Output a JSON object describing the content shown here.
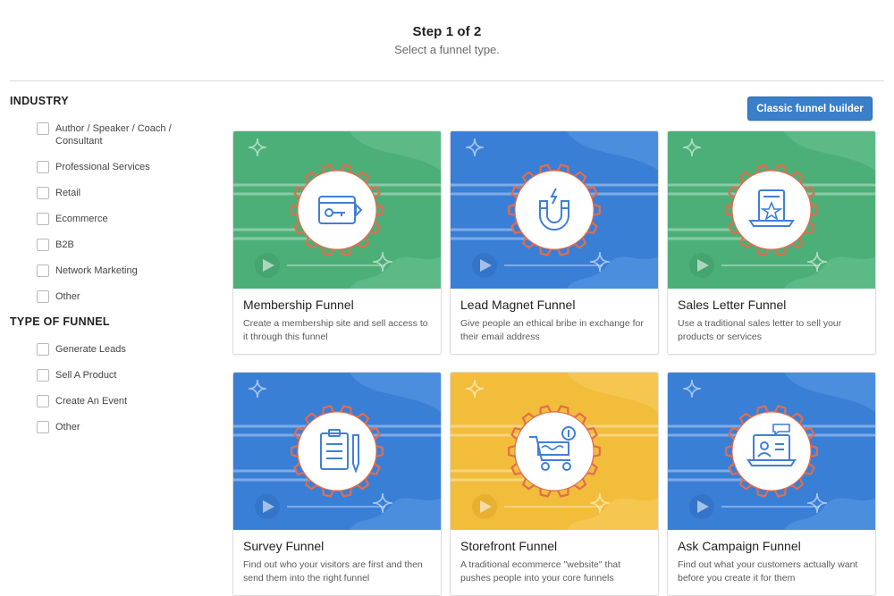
{
  "header": {
    "step": "Step 1 of 2",
    "subtitle": "Select a funnel type."
  },
  "filters": {
    "industry_title": "INDUSTRY",
    "industry": [
      {
        "label": "Author / Speaker / Coach / Consultant",
        "checked": false
      },
      {
        "label": "Professional Services",
        "checked": false
      },
      {
        "label": "Retail",
        "checked": false
      },
      {
        "label": "Ecommerce",
        "checked": false
      },
      {
        "label": "B2B",
        "checked": false
      },
      {
        "label": "Network Marketing",
        "checked": false
      },
      {
        "label": "Other",
        "checked": false
      }
    ],
    "type_title": "TYPE OF FUNNEL",
    "type": [
      {
        "label": "Generate Leads",
        "checked": false
      },
      {
        "label": "Sell A Product",
        "checked": false
      },
      {
        "label": "Create An Event",
        "checked": false
      },
      {
        "label": "Other",
        "checked": false
      }
    ]
  },
  "actions": {
    "classic_builder": "Classic funnel builder"
  },
  "colors": {
    "green": "#4caf78",
    "blue": "#3a7fd6",
    "yellow": "#f2bd3b",
    "accent_button": "#3a7fc9",
    "badge_orange": "#e0704f",
    "icon_blue": "#3f7fd6"
  },
  "cards": [
    {
      "title": "Membership Funnel",
      "desc": "Create a membership site and sell access to it through this funnel",
      "theme": "green",
      "icon": "membership-card-icon"
    },
    {
      "title": "Lead Magnet Funnel",
      "desc": "Give people an ethical bribe in exchange for their email address",
      "theme": "blue",
      "icon": "magnet-icon"
    },
    {
      "title": "Sales Letter Funnel",
      "desc": "Use a traditional sales letter to sell your products or services",
      "theme": "green",
      "icon": "sales-letter-icon"
    },
    {
      "title": "Survey Funnel",
      "desc": "Find out who your visitors are first and then send them into the right funnel",
      "theme": "blue",
      "icon": "clipboard-icon"
    },
    {
      "title": "Storefront Funnel",
      "desc": "A traditional ecommerce \"website\" that pushes people into your core funnels",
      "theme": "yellow",
      "icon": "shopping-cart-icon"
    },
    {
      "title": "Ask Campaign Funnel",
      "desc": "Find out what your customers actually want before you create it for them",
      "theme": "blue",
      "icon": "ask-laptop-icon"
    }
  ]
}
